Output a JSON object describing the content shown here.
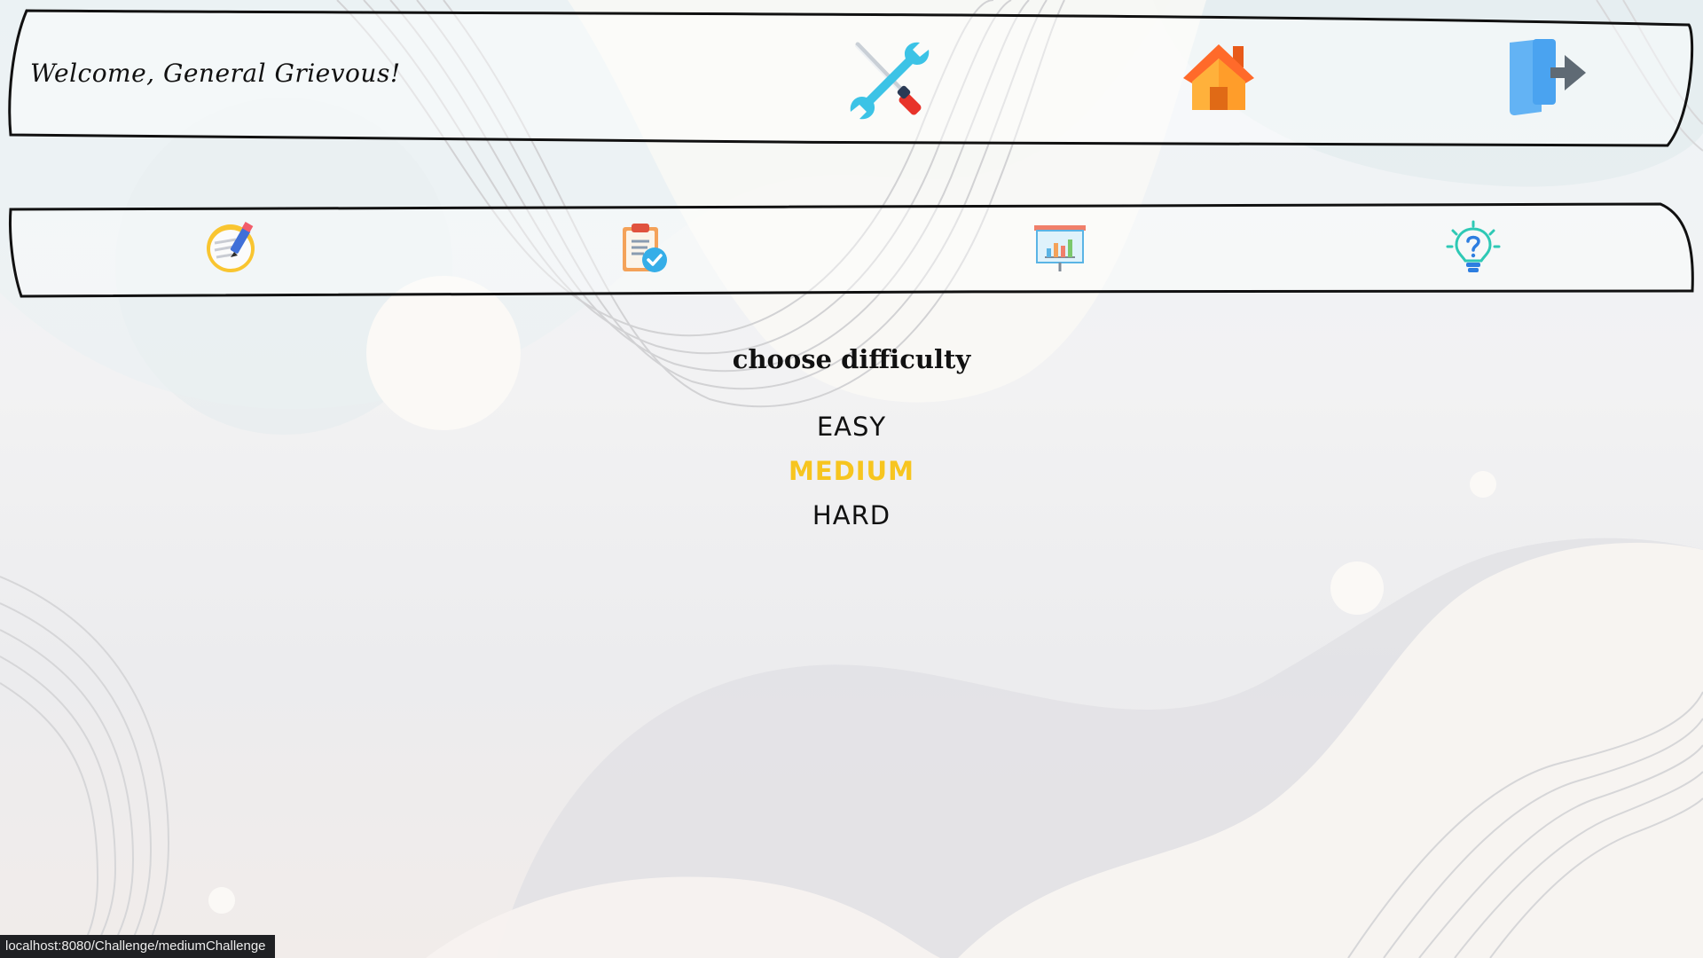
{
  "header": {
    "welcome_text": "Welcome, General Grievous!",
    "icons": [
      "tools-icon",
      "home-icon",
      "logout-icon"
    ]
  },
  "nav": {
    "icons": [
      "notes-icon",
      "clipboard-check-icon",
      "statistics-board-icon",
      "lightbulb-help-icon"
    ]
  },
  "main": {
    "title": "choose difficulty",
    "options": [
      {
        "label": "EASY",
        "active": false
      },
      {
        "label": "MEDIUM",
        "active": true
      },
      {
        "label": "HARD",
        "active": false
      }
    ]
  },
  "status_bar": {
    "url": "localhost:8080/Challenge/mediumChallenge"
  },
  "colors": {
    "accent": "#f7c51f",
    "text": "#111111",
    "home_orange": "#ff8a1e",
    "logout_blue": "#4aa3f0",
    "tools_cyan": "#3cc3e6"
  }
}
